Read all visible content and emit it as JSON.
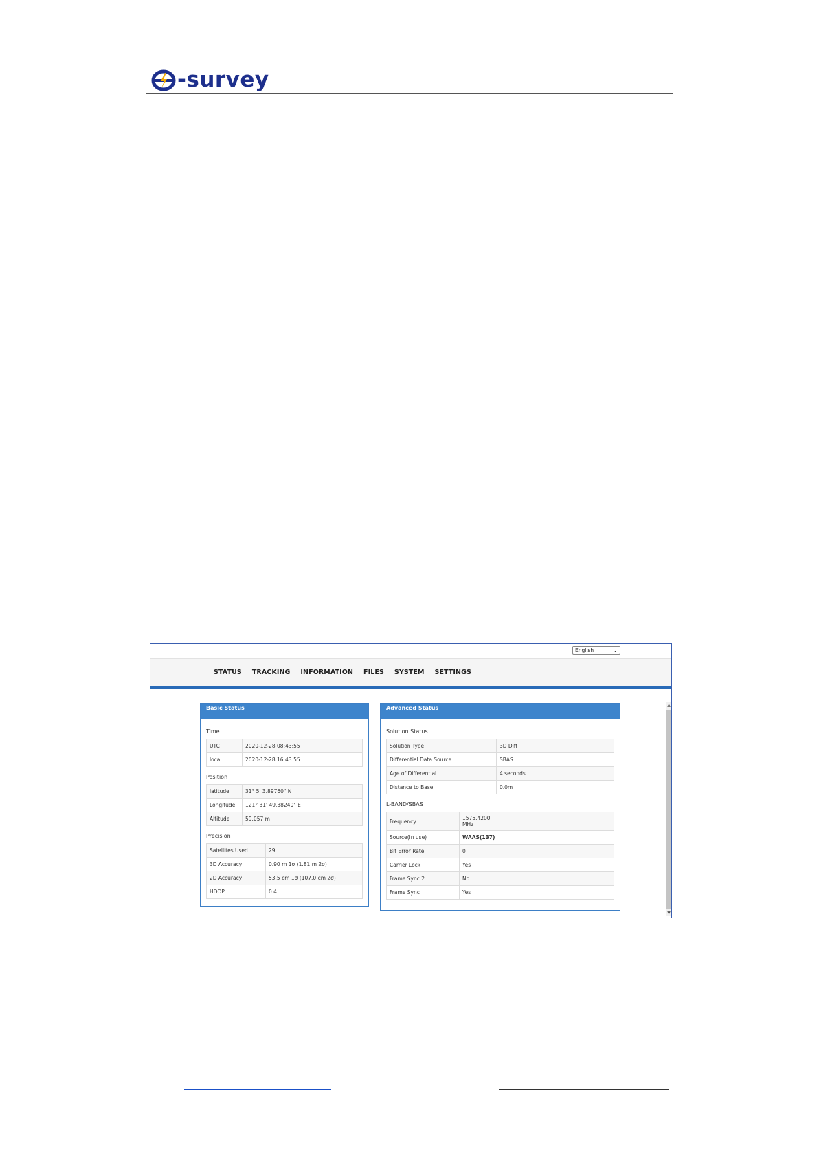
{
  "document": {
    "logo_text": "-survey",
    "brand_color": "#1d2f8c",
    "accent_color": "#f2a900"
  },
  "screenshot": {
    "language": {
      "selected": "English"
    },
    "nav": [
      "STATUS",
      "TRACKING",
      "INFORMATION",
      "FILES",
      "SYSTEM",
      "SETTINGS"
    ],
    "basic": {
      "title": "Basic Status",
      "sections": [
        {
          "title": "Time",
          "rows": [
            [
              "UTC",
              "2020-12-28 08:43:55"
            ],
            [
              "local",
              "2020-12-28 16:43:55"
            ]
          ]
        },
        {
          "title": "Position",
          "rows": [
            [
              "latitude",
              "31° 5' 3.89760\" N"
            ],
            [
              "Longitude",
              "121° 31' 49.38240\" E"
            ],
            [
              "Altitude",
              "59.057 m"
            ]
          ]
        },
        {
          "title": "Precision",
          "rows": [
            [
              "Satellites Used",
              "29"
            ],
            [
              "3D Accuracy",
              "0.90 m 1σ (1.81 m 2σ)"
            ],
            [
              "2D Accuracy",
              "53.5 cm 1σ (107.0 cm 2σ)"
            ],
            [
              "HDOP",
              "0.4"
            ]
          ]
        }
      ]
    },
    "advanced": {
      "title": "Advanced Status",
      "sections": [
        {
          "title": "Solution Status",
          "rows": [
            [
              "Solution Type",
              "3D Diff"
            ],
            [
              "Differential Data Source",
              "SBAS"
            ],
            [
              "Age of Differential",
              "4 seconds"
            ],
            [
              "Distance to Base",
              "0.0m"
            ]
          ]
        },
        {
          "title": "L-BAND/SBAS",
          "rows": [
            [
              "Frequency",
              "1575.4200",
              "MHz"
            ],
            [
              "Source(in use)",
              "WAAS(137)"
            ],
            [
              "Bit Error Rate",
              "0"
            ],
            [
              "Carrier Lock",
              "Yes"
            ],
            [
              "Frame Sync 2",
              "No"
            ],
            [
              "Frame Sync",
              "Yes"
            ]
          ]
        }
      ]
    }
  }
}
